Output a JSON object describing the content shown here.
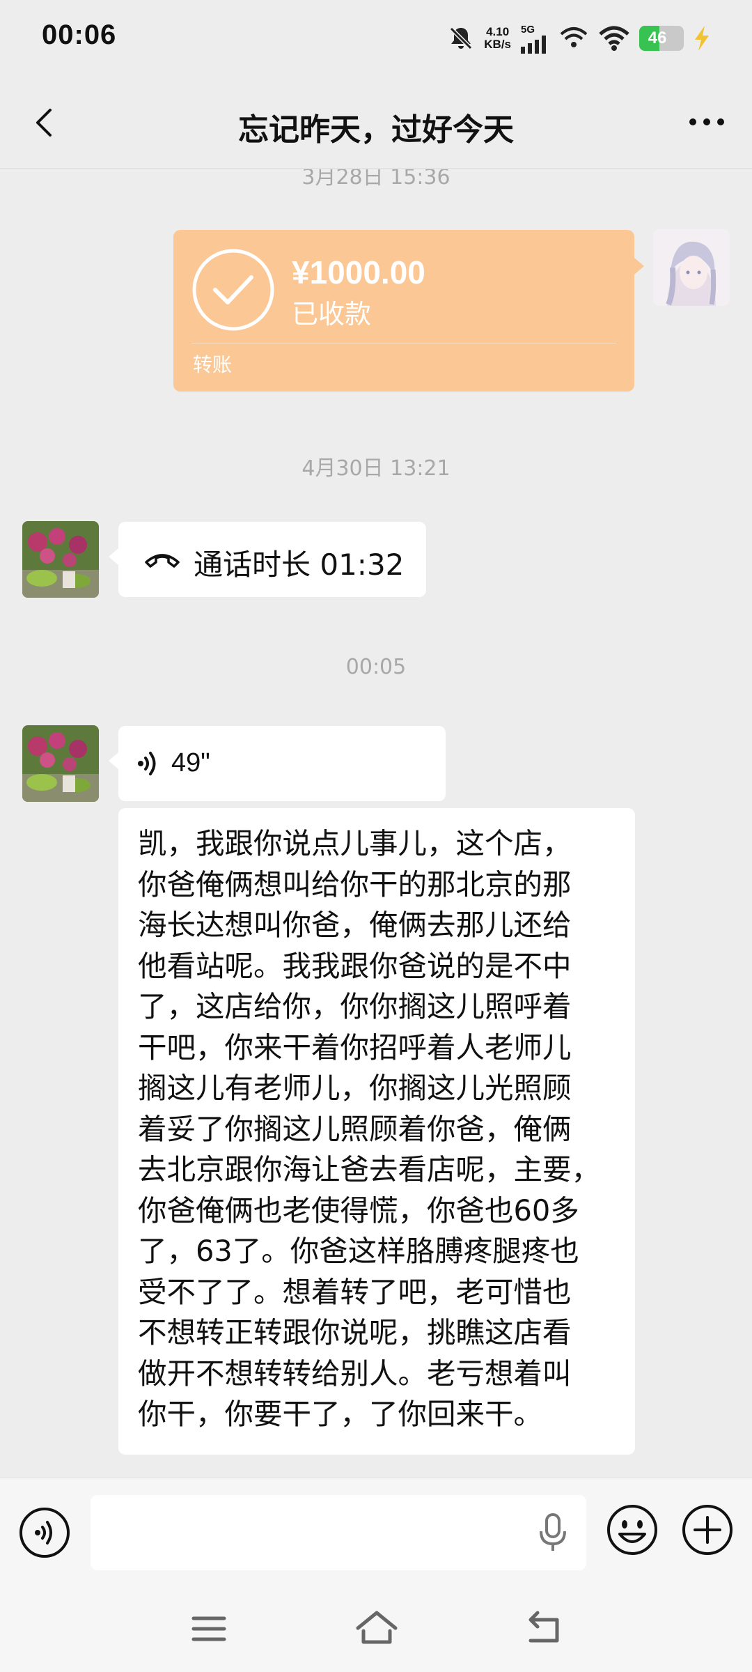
{
  "status_bar": {
    "time": "00:06",
    "speed_value": "4.10",
    "speed_unit": "KB/s",
    "network": "5G",
    "battery_level": "46",
    "battery_color": "#38c251"
  },
  "header": {
    "title": "忘记昨天，过好今天",
    "back_icon": "chevron-left-icon",
    "more_icon": "more-horizontal-icon"
  },
  "messages": {
    "top_timestamp": "3月28日 15:36",
    "transfer": {
      "amount": "¥1000.00",
      "status": "已收款",
      "label": "转账",
      "color": "#fbc794"
    },
    "timestamp_2": "4月30日 13:21",
    "call": {
      "text": "通话时长 01:32"
    },
    "timestamp_3": "00:05",
    "voice": {
      "duration": "49\""
    },
    "transcript": "凯，我跟你说点儿事儿，这个店，\n你爸俺俩想叫给你干的那北京的那\n海长达想叫你爸，俺俩去那儿还给\n他看站呢。我我跟你爸说的是不中\n了，这店给你，你你搁这儿照呼着\n干吧，你来干着你招呼着人老师儿\n搁这儿有老师儿，你搁这儿光照顾\n着妥了你搁这儿照顾着你爸，俺俩\n去北京跟你海让爸去看店呢，主要，\n你爸俺俩也老使得慌，你爸也60多\n了，63了。你爸这样胳膊疼腿疼也\n受不了了。想着转了吧，老可惜也\n不想转正转跟你说呢，挑瞧这店看\n做开不想转转给别人。老亏想着叫\n你干，你要干了，了你回来干。"
  },
  "input_bar": {
    "text_value": "",
    "icons": [
      "voice-toggle-icon",
      "microphone-icon",
      "emoji-icon",
      "plus-icon"
    ]
  },
  "nav_bar": {
    "icons": [
      "menu-icon",
      "home-icon",
      "back-icon"
    ]
  }
}
